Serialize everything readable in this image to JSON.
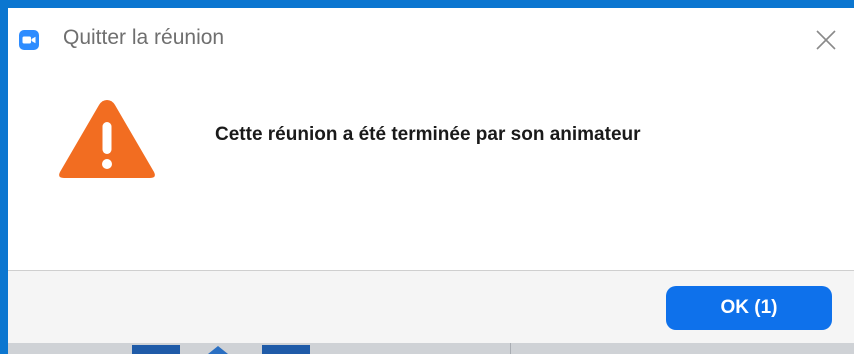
{
  "window": {
    "title": "Quitter la réunion",
    "app_icon": "zoom-camera-icon",
    "close_icon": "close-icon"
  },
  "dialog": {
    "warning_icon": "warning-icon",
    "message": "Cette réunion a été terminée par son animateur"
  },
  "footer": {
    "ok_label": "OK (1)"
  },
  "colors": {
    "frame_border": "#0b76d0",
    "ok_button": "#0e71eb",
    "warning": "#f26d21",
    "app_icon": "#2d8cff"
  }
}
